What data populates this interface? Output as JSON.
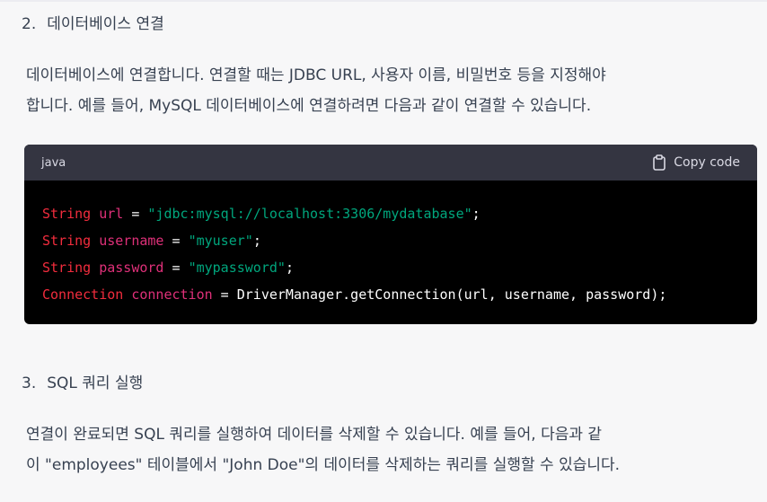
{
  "section2": {
    "number": "2.",
    "title": "데이터베이스 연결"
  },
  "intro": {
    "line1": "데이터베이스에 연결합니다. 연결할 때는 JDBC URL, 사용자 이름, 비밀번호 등을 지정해야",
    "line2": "합니다. 예를 들어, MySQL 데이터베이스에 연결하려면 다음과 같이 연결할 수 있습니다."
  },
  "code_block": {
    "language": "java",
    "copy_label": "Copy code",
    "copy_icon": "clipboard-icon",
    "lines": [
      {
        "type": "String",
        "var": "url",
        "op": " = ",
        "value": "\"jdbc:mysql://localhost:3306/mydatabase\"",
        "end": ";"
      },
      {
        "type": "String",
        "var": "username",
        "op": " = ",
        "value": "\"myuser\"",
        "end": ";"
      },
      {
        "type": "String",
        "var": "password",
        "op": " = ",
        "value": "\"mypassword\"",
        "end": ";"
      },
      {
        "type": "Connection",
        "var": "connection",
        "op": " = ",
        "value": "DriverManager.getConnection(url, username, password)",
        "end": ";"
      }
    ]
  },
  "section3": {
    "number": "3.",
    "title": "SQL 쿼리 실행"
  },
  "outro": {
    "line1": "연결이 완료되면 SQL 쿼리를 실행하여 데이터를 삭제할 수 있습니다. 예를 들어, 다음과 같",
    "line2": "이 \"employees\" 테이블에서 \"John Doe\"의 데이터를 삭제하는 쿼리를 실행할 수 있습니다."
  },
  "colors": {
    "page_bg": "#f7f7f8",
    "text": "#374151",
    "code_bg": "#000000",
    "code_header_bg": "#343541",
    "keyword": "#f22c3d",
    "variable": "#df3079",
    "string": "#00a67d"
  }
}
